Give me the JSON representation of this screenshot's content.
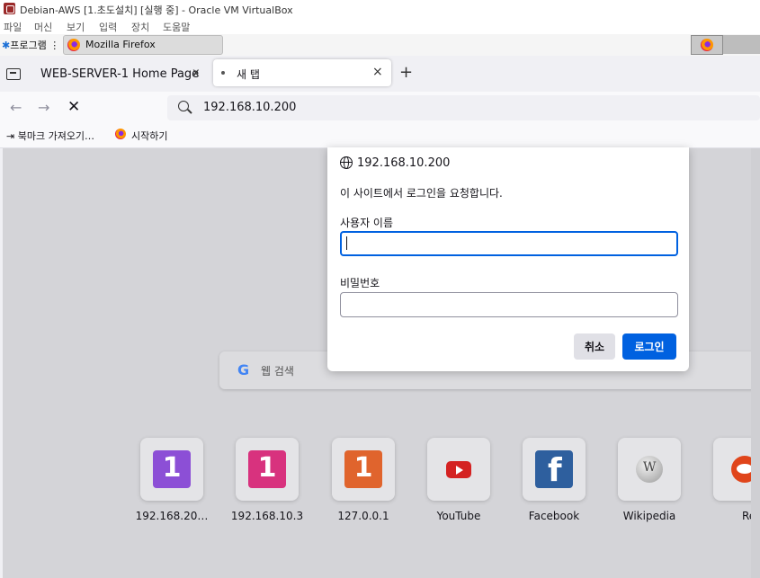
{
  "vbox": {
    "title": "Debian-AWS [1.초도설치] [실행 중] - Oracle VM VirtualBox",
    "menu": [
      "파일",
      "머신",
      "보기",
      "입력",
      "장치",
      "도움말"
    ],
    "taskbar_programs": "프로그램",
    "taskbar_firefox": "Mozilla Firefox"
  },
  "browser": {
    "tabs": [
      {
        "label": "WEB-SERVER-1 Home Page",
        "close": "x"
      },
      {
        "label": "새 탭",
        "close": "×"
      }
    ],
    "new_tab": "+",
    "nav": {
      "back": "←",
      "forward": "→",
      "stop": "✕"
    },
    "url": "192.168.10.200",
    "bookmarks": [
      {
        "label": "북마크 가져오기…",
        "icon": "import-icon"
      },
      {
        "label": "시작하기",
        "icon": "firefox-icon"
      }
    ]
  },
  "newtab": {
    "search_g": "G",
    "search_placeholder": "웹 검색",
    "top_sites": [
      {
        "name": "192.168.20…",
        "icon": "1",
        "color": "#8c4fd6"
      },
      {
        "name": "192.168.10.3",
        "icon": "1",
        "color": "#d8327e"
      },
      {
        "name": "127.0.0.1",
        "icon": "1",
        "color": "#e0642d"
      },
      {
        "name": "YouTube",
        "icon": "youtube-icon",
        "color": "#ff0000"
      },
      {
        "name": "Facebook",
        "icon": "facebook-icon",
        "color": "#1877f2"
      },
      {
        "name": "Wikipedia",
        "icon": "wikipedia-icon",
        "color": "#888888"
      },
      {
        "name": "Reddi",
        "icon": "reddit-icon",
        "color": "#ff4500"
      }
    ]
  },
  "dialog": {
    "host": "192.168.10.200",
    "message": "이 사이트에서 로그인을 요청합니다.",
    "username_label": "사용자 이름",
    "username_value": "",
    "password_label": "비밀번호",
    "password_value": "",
    "cancel": "취소",
    "login": "로그인"
  }
}
